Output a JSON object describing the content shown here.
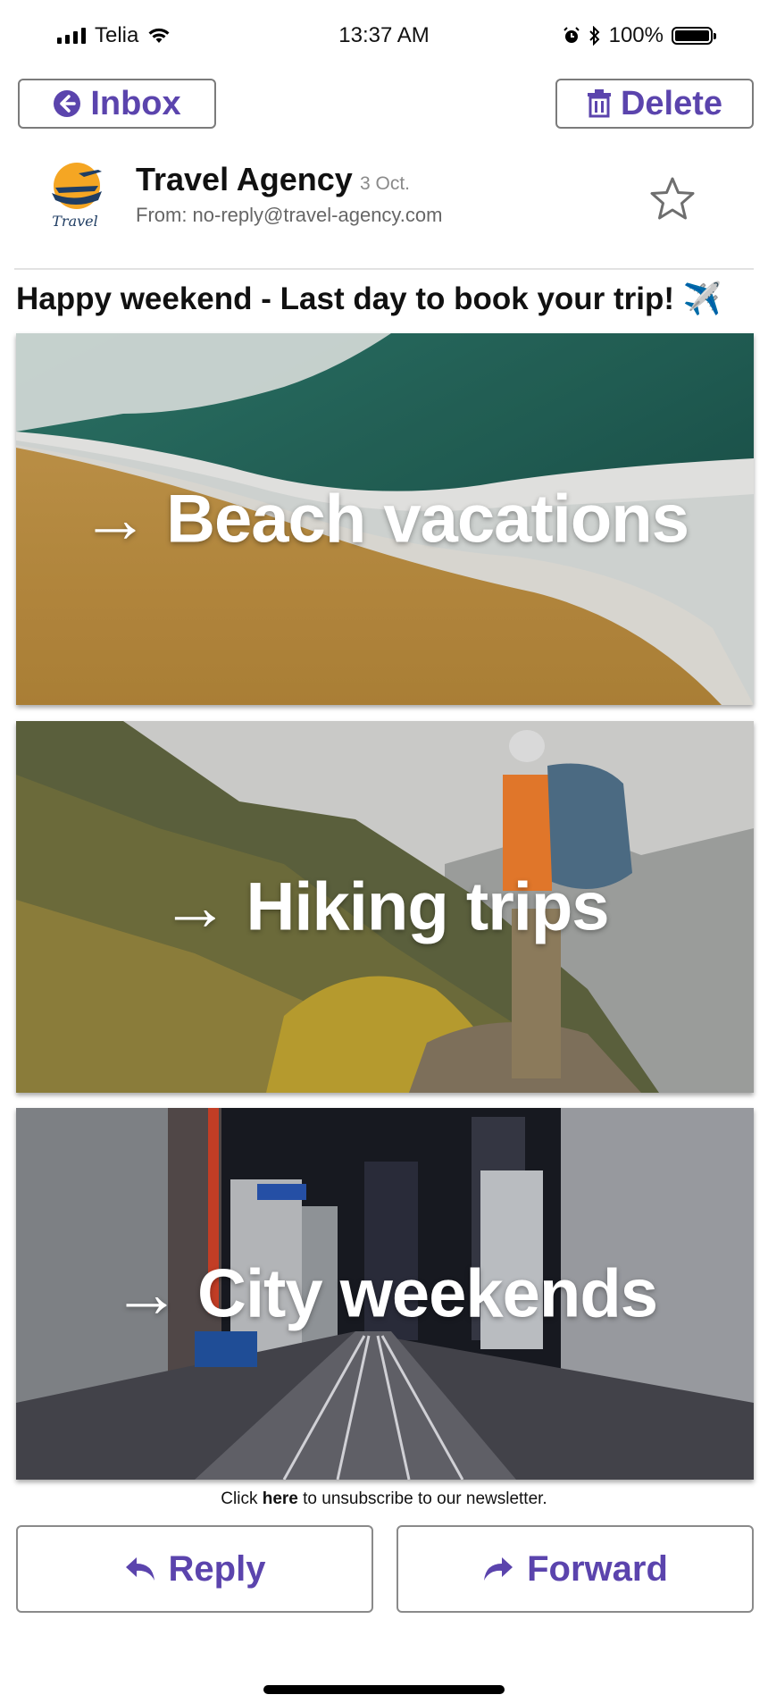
{
  "status_bar": {
    "carrier": "Telia",
    "time": "13:37 AM",
    "battery": "100%"
  },
  "toolbar": {
    "inbox_label": "Inbox",
    "delete_label": "Delete"
  },
  "email": {
    "sender": "Travel Agency",
    "date": "3 Oct.",
    "from": "From: no-reply@travel-agency.com",
    "logo_text": "Travel",
    "subject": "Happy weekend - Last day to book your trip! ✈️",
    "banners": [
      {
        "label": "→ Beach vacations"
      },
      {
        "label": "→ Hiking trips"
      },
      {
        "label": "→ City weekends"
      }
    ],
    "unsubscribe": {
      "prefix": "Click ",
      "link": "here",
      "suffix": " to unsubscribe to our newsletter."
    }
  },
  "actions": {
    "reply_label": "Reply",
    "forward_label": "Forward"
  },
  "colors": {
    "accent": "#5b44ad"
  }
}
